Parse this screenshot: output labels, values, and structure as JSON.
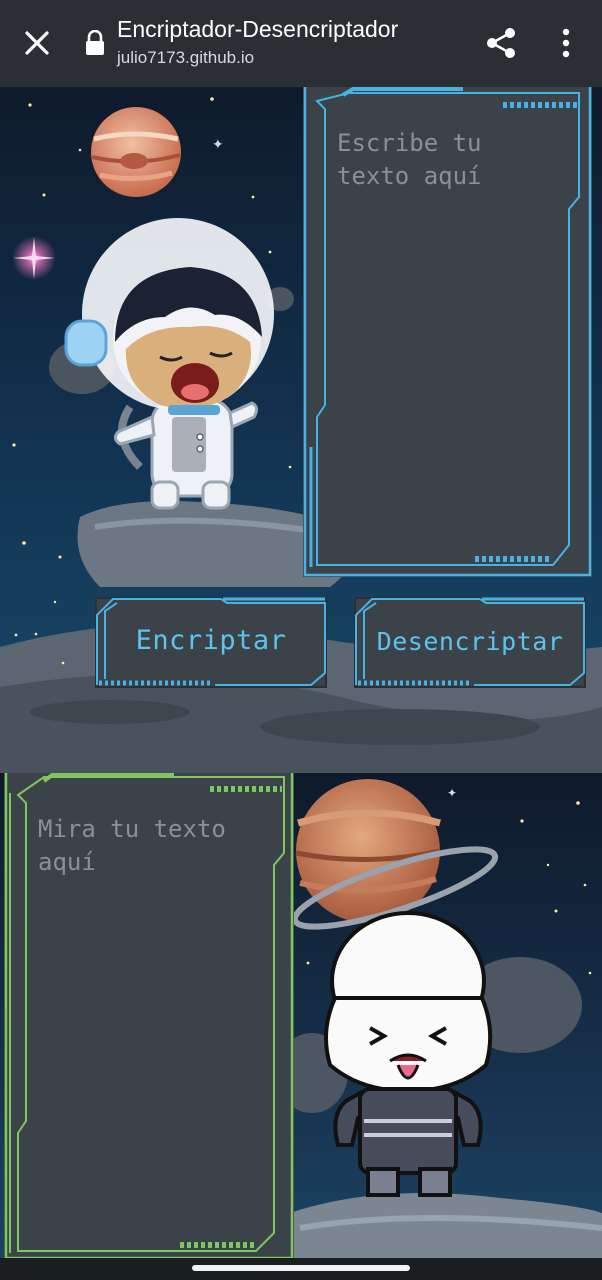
{
  "browser": {
    "page_title": "Encriptador-Desencriptador",
    "url": "julio7173.github.io",
    "icons": {
      "close": "close-icon",
      "lock": "lock-icon",
      "share": "share-icon",
      "more": "more-vert-icon"
    }
  },
  "input_panel": {
    "placeholder": "Escribe tu texto aquí"
  },
  "buttons": {
    "encrypt": "Encriptar",
    "decrypt": "Desencriptar"
  },
  "output_panel": {
    "placeholder": "Mira tu texto aquí"
  },
  "colors": {
    "blue_frame": "#47b2e6",
    "green_frame": "#7fc560",
    "panel_bg": "#3b4248",
    "button_text": "#5cc4ee"
  }
}
